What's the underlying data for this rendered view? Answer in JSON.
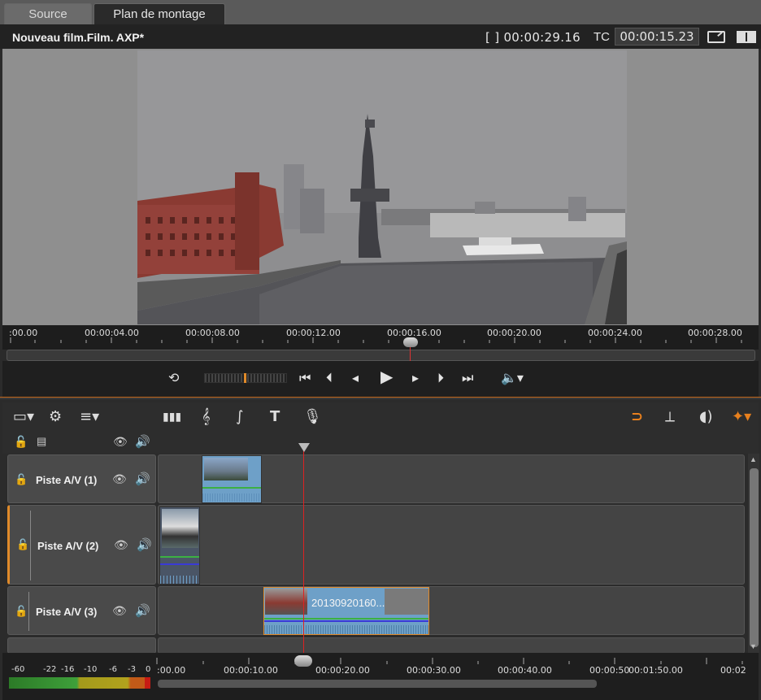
{
  "tabs": {
    "source": "Source",
    "timeline": "Plan de montage"
  },
  "player": {
    "title": "Nouveau film.Film. AXP*",
    "duration": "[ ] 00:00:29.16",
    "tc_label": "TC",
    "tc_value": "00:00:15.23"
  },
  "ruler_top": [
    ":00.00",
    "00:00:04.00",
    "00:00:08.00",
    "00:00:12.00",
    "00:00:16.00",
    "00:00:20.00",
    "00:00:24.00",
    "00:00:28.00"
  ],
  "playback_position": 0.55,
  "tracks": [
    {
      "name": "Piste A/V (1)"
    },
    {
      "name": "Piste A/V (2)"
    },
    {
      "name": "Piste A/V (3)",
      "clip_label": "20130920160..."
    }
  ],
  "ruler_bottom": [
    ":00.00",
    "00:00:10.00",
    "00:00:20.00",
    "00:00:30.00",
    "00:00:40.00",
    "00:00:50",
    "00:01:50.00",
    "00:02"
  ],
  "vu_labels": [
    "-60",
    "-22",
    "-16",
    "-10",
    "-6",
    "-3",
    "0"
  ],
  "icons": [
    "loop-icon",
    "skip-start-icon",
    "prev-frame-icon",
    "step-back-icon",
    "play-icon",
    "step-forward-icon",
    "next-frame-icon",
    "skip-end-icon",
    "volume-icon",
    "magnet-icon",
    "eye-icon",
    "speaker-icon",
    "lock-icon",
    "magic-wand-icon"
  ],
  "colors": {
    "accent": "#e08a2a",
    "playhead": "#d33333",
    "clip_audio_green": "#3cb043",
    "clip_audio_blue": "#3a3ad6"
  }
}
